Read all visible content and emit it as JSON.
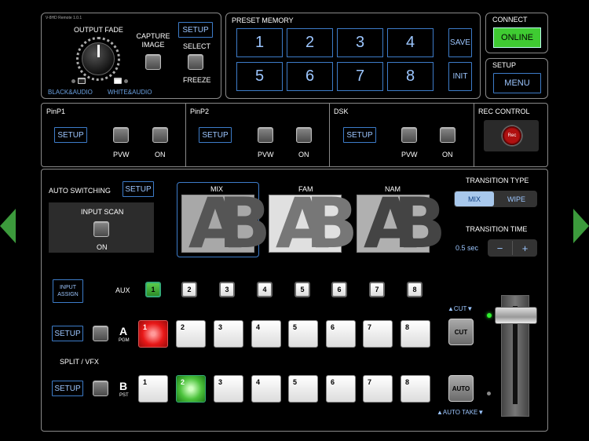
{
  "app_version": "V-8HD Remote 1.0.1",
  "output_fade": {
    "title": "OUTPUT FADE",
    "left_label": "BLACK&AUDIO",
    "right_label": "WHITE&AUDIO"
  },
  "capture": {
    "label": "CAPTURE\nIMAGE",
    "setup_label": "SETUP",
    "select_label": "SELECT",
    "freeze_label": "FREEZE"
  },
  "preset_memory": {
    "title": "PRESET MEMORY",
    "numbers": [
      "1",
      "2",
      "3",
      "4",
      "5",
      "6",
      "7",
      "8"
    ],
    "save_label": "SAVE",
    "init_label": "INIT"
  },
  "connect": {
    "title": "CONNECT",
    "button_label": "ONLINE",
    "accent": "#3fcb32"
  },
  "setup_menu": {
    "title": "SETUP",
    "button_label": "MENU"
  },
  "pinp1": {
    "title": "PinP1",
    "setup": "SETUP",
    "pvw": "PVW",
    "on": "ON"
  },
  "pinp2": {
    "title": "PinP2",
    "setup": "SETUP",
    "pvw": "PVW",
    "on": "ON"
  },
  "dsk": {
    "title": "DSK",
    "setup": "SETUP",
    "pvw": "PVW",
    "on": "ON"
  },
  "rec_control": {
    "title": "REC CONTROL",
    "rec_label": "Rec"
  },
  "auto_switching": {
    "title": "AUTO SWITCHING",
    "setup": "SETUP",
    "scan_label": "INPUT SCAN",
    "on_label": "ON"
  },
  "transitions": {
    "mix": "MIX",
    "fam": "FAM",
    "nam": "NAM",
    "type_title": "TRANSITION TYPE",
    "type_mix": "MIX",
    "type_wipe": "WIPE",
    "time_title": "TRANSITION TIME",
    "time_value": "0.5 sec",
    "minus": "−",
    "plus": "+"
  },
  "input_assign": "INPUT\nASSIGN",
  "aux": {
    "label": "AUX",
    "numbers": [
      "1",
      "2",
      "3",
      "4",
      "5",
      "6",
      "7",
      "8"
    ],
    "active": "1"
  },
  "bus_a": {
    "letter": "A",
    "sub": "PGM",
    "setup": "SETUP",
    "numbers": [
      "1",
      "2",
      "3",
      "4",
      "5",
      "6",
      "7",
      "8"
    ],
    "active": "1"
  },
  "split_vfx": "SPLIT / VFX",
  "bus_b": {
    "letter": "B",
    "sub": "PST",
    "setup": "SETUP",
    "numbers": [
      "1",
      "2",
      "3",
      "4",
      "5",
      "6",
      "7",
      "8"
    ],
    "active": "2"
  },
  "cut": {
    "top_label": "▲CUT▼",
    "button": "CUT"
  },
  "auto": {
    "button": "AUTO",
    "bottom_label": "▲AUTO TAKE▼"
  }
}
